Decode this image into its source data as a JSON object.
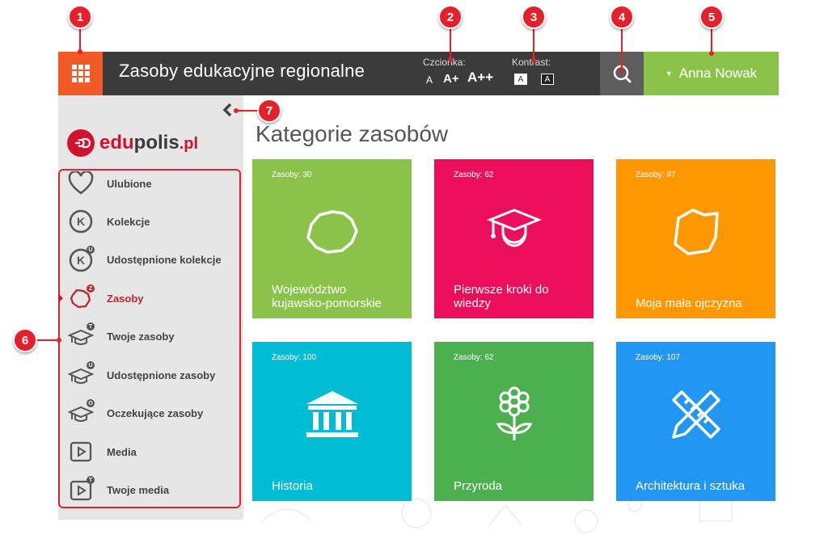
{
  "header": {
    "title": "Zasoby edukacyjne regionalne",
    "font_label": "Czcionka:",
    "font_sizes": [
      "A",
      "A+",
      "A++"
    ],
    "contrast_label": "Kontrast:",
    "contrast_options": [
      "A",
      "A"
    ],
    "user_name": "Anna Nowak"
  },
  "logo": {
    "brand_red": "edu",
    "brand_dark": "polis",
    "brand_suffix": ".pl"
  },
  "sidebar": {
    "items": [
      {
        "label": "Ulubione",
        "icon": "heart-icon",
        "badge": ""
      },
      {
        "label": "Kolekcje",
        "icon": "collection-k-icon",
        "badge": ""
      },
      {
        "label": "Udostępnione kolekcje",
        "icon": "collection-k-icon",
        "badge": "U"
      },
      {
        "label": "Zasoby",
        "icon": "region-map-icon",
        "badge": "Z"
      },
      {
        "label": "Twoje zasoby",
        "icon": "graduation-cap-icon",
        "badge": "T"
      },
      {
        "label": "Udostępnione zasoby",
        "icon": "graduation-cap-icon",
        "badge": "U"
      },
      {
        "label": "Oczekujące zasoby",
        "icon": "graduation-cap-icon",
        "badge": "O"
      },
      {
        "label": "Media",
        "icon": "play-icon",
        "badge": ""
      },
      {
        "label": "Twoje media",
        "icon": "play-icon",
        "badge": "T"
      }
    ]
  },
  "main": {
    "page_title": "Kategorie zasobów",
    "tiles": [
      {
        "count": "Zasoby: 30",
        "name": "Województwo kujawsko-pomorskie",
        "color": "#8bc34a",
        "icon": "region-map-icon"
      },
      {
        "count": "Zasoby: 62",
        "name": "Pierwsze kroki do wiedzy",
        "color": "#ec0e5b",
        "icon": "graduate-icon"
      },
      {
        "count": "Zasoby: 97",
        "name": "Moja mała ojczyzna",
        "color": "#ff9800",
        "icon": "country-map-icon"
      },
      {
        "count": "Zasoby: 100",
        "name": "Historia",
        "color": "#00bcd4",
        "icon": "museum-icon"
      },
      {
        "count": "Zasoby: 62",
        "name": "Przyroda",
        "color": "#4caf50",
        "icon": "flower-icon"
      },
      {
        "count": "Zasoby: 107",
        "name": "Architektura i sztuka",
        "color": "#2196f3",
        "icon": "ruler-pencil-icon"
      }
    ]
  },
  "callouts": [
    "1",
    "2",
    "3",
    "4",
    "5",
    "6",
    "7"
  ],
  "colors": {
    "accent_orange": "#f15a24",
    "user_green": "#8bc34a",
    "callout_red": "#e4202a"
  }
}
